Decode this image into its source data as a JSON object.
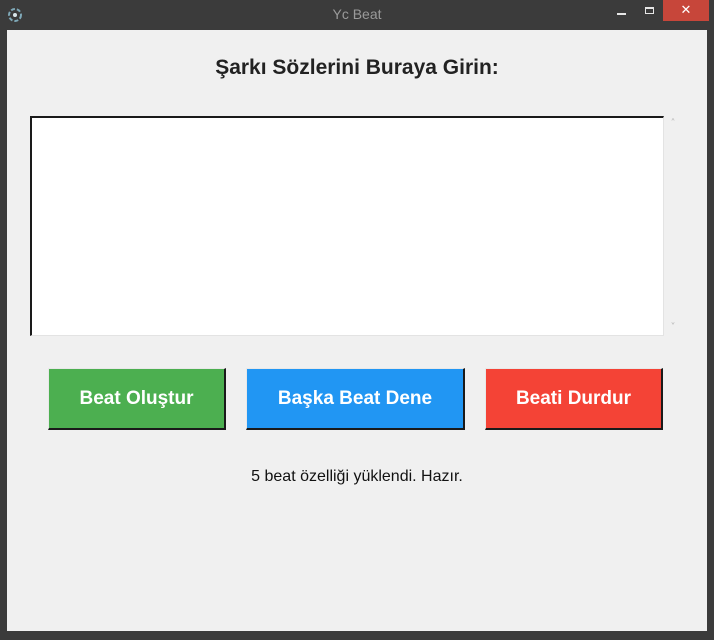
{
  "window": {
    "title": "Yc Beat",
    "icon": "app-logo-icon",
    "controls": {
      "minimize_icon": "minimize-icon",
      "maximize_icon": "maximize-icon",
      "close_icon": "close-icon",
      "close_glyph": "✕"
    }
  },
  "main": {
    "heading": "Şarkı Sözlerini Buraya Girin:",
    "lyrics_input": {
      "value": "",
      "placeholder": ""
    },
    "scrollbar": {
      "up_arrow": "˄",
      "down_arrow": "˅"
    },
    "buttons": {
      "create_label": "Beat Oluştur",
      "try_another_label": "Başka Beat Dene",
      "stop_label": "Beati Durdur"
    },
    "status_text": "5 beat özelliği yüklendi. Hazır."
  },
  "colors": {
    "create_button": "#4caf50",
    "try_another_button": "#2196f3",
    "stop_button": "#f44336",
    "close_button": "#c7463a",
    "titlebar": "#3b3b3b",
    "background": "#f0f0f0"
  }
}
